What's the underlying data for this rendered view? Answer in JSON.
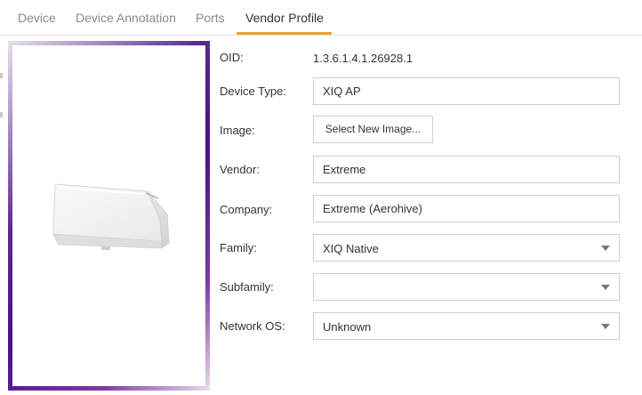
{
  "tabs": [
    {
      "label": "Device"
    },
    {
      "label": "Device Annotation"
    },
    {
      "label": "Ports"
    },
    {
      "label": "Vendor Profile"
    }
  ],
  "active_tab": "Vendor Profile",
  "accent_color": "#e3a72f",
  "image_panel": {
    "icon": "access-point-device-image"
  },
  "form": {
    "oid": {
      "label": "OID:",
      "value": "1.3.6.1.4.1.26928.1"
    },
    "device_type": {
      "label": "Device Type:",
      "value": "XIQ AP"
    },
    "image": {
      "label": "Image:",
      "button": "Select New Image..."
    },
    "vendor": {
      "label": "Vendor:",
      "value": "Extreme"
    },
    "company": {
      "label": "Company:",
      "value": "Extreme (Aerohive)"
    },
    "family": {
      "label": "Family:",
      "value": "XIQ Native"
    },
    "subfamily": {
      "label": "Subfamily:",
      "value": ""
    },
    "network_os": {
      "label": "Network OS:",
      "value": "Unknown"
    }
  }
}
